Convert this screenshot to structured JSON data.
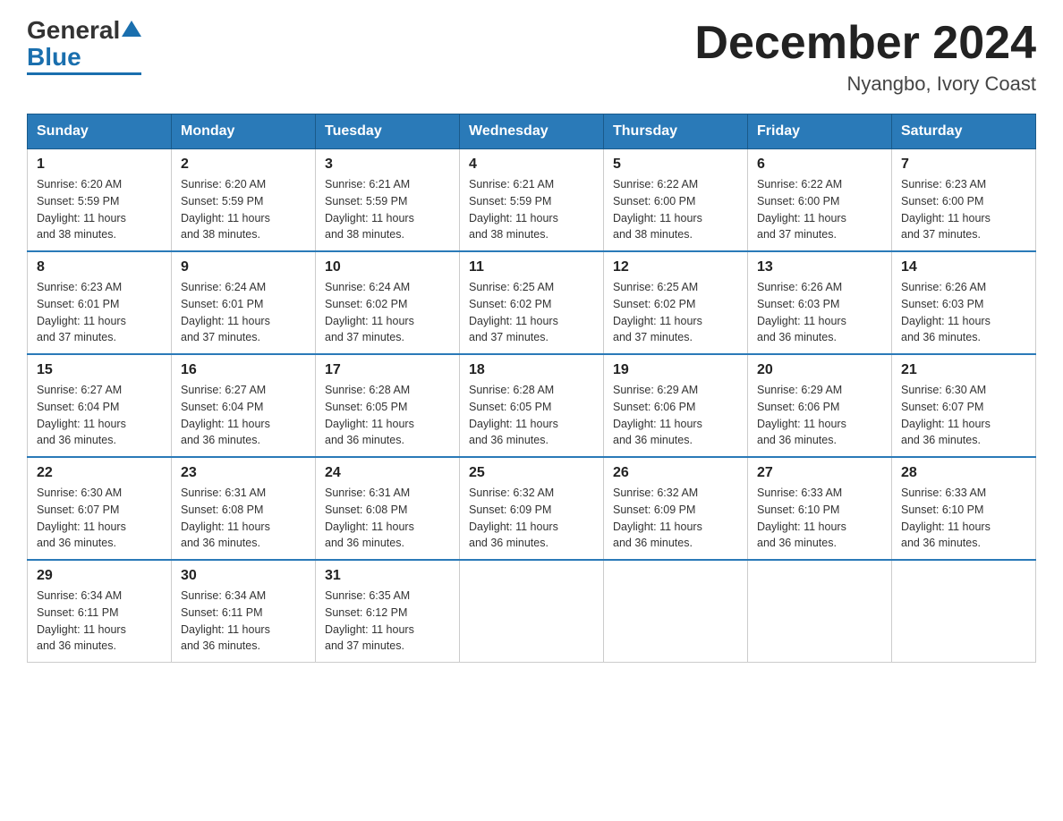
{
  "header": {
    "logo_general": "General",
    "logo_blue": "Blue",
    "month_title": "December 2024",
    "location": "Nyangbo, Ivory Coast"
  },
  "weekdays": [
    "Sunday",
    "Monday",
    "Tuesday",
    "Wednesday",
    "Thursday",
    "Friday",
    "Saturday"
  ],
  "weeks": [
    [
      {
        "day": "1",
        "sunrise": "6:20 AM",
        "sunset": "5:59 PM",
        "daylight": "11 hours and 38 minutes."
      },
      {
        "day": "2",
        "sunrise": "6:20 AM",
        "sunset": "5:59 PM",
        "daylight": "11 hours and 38 minutes."
      },
      {
        "day": "3",
        "sunrise": "6:21 AM",
        "sunset": "5:59 PM",
        "daylight": "11 hours and 38 minutes."
      },
      {
        "day": "4",
        "sunrise": "6:21 AM",
        "sunset": "5:59 PM",
        "daylight": "11 hours and 38 minutes."
      },
      {
        "day": "5",
        "sunrise": "6:22 AM",
        "sunset": "6:00 PM",
        "daylight": "11 hours and 38 minutes."
      },
      {
        "day": "6",
        "sunrise": "6:22 AM",
        "sunset": "6:00 PM",
        "daylight": "11 hours and 37 minutes."
      },
      {
        "day": "7",
        "sunrise": "6:23 AM",
        "sunset": "6:00 PM",
        "daylight": "11 hours and 37 minutes."
      }
    ],
    [
      {
        "day": "8",
        "sunrise": "6:23 AM",
        "sunset": "6:01 PM",
        "daylight": "11 hours and 37 minutes."
      },
      {
        "day": "9",
        "sunrise": "6:24 AM",
        "sunset": "6:01 PM",
        "daylight": "11 hours and 37 minutes."
      },
      {
        "day": "10",
        "sunrise": "6:24 AM",
        "sunset": "6:02 PM",
        "daylight": "11 hours and 37 minutes."
      },
      {
        "day": "11",
        "sunrise": "6:25 AM",
        "sunset": "6:02 PM",
        "daylight": "11 hours and 37 minutes."
      },
      {
        "day": "12",
        "sunrise": "6:25 AM",
        "sunset": "6:02 PM",
        "daylight": "11 hours and 37 minutes."
      },
      {
        "day": "13",
        "sunrise": "6:26 AM",
        "sunset": "6:03 PM",
        "daylight": "11 hours and 36 minutes."
      },
      {
        "day": "14",
        "sunrise": "6:26 AM",
        "sunset": "6:03 PM",
        "daylight": "11 hours and 36 minutes."
      }
    ],
    [
      {
        "day": "15",
        "sunrise": "6:27 AM",
        "sunset": "6:04 PM",
        "daylight": "11 hours and 36 minutes."
      },
      {
        "day": "16",
        "sunrise": "6:27 AM",
        "sunset": "6:04 PM",
        "daylight": "11 hours and 36 minutes."
      },
      {
        "day": "17",
        "sunrise": "6:28 AM",
        "sunset": "6:05 PM",
        "daylight": "11 hours and 36 minutes."
      },
      {
        "day": "18",
        "sunrise": "6:28 AM",
        "sunset": "6:05 PM",
        "daylight": "11 hours and 36 minutes."
      },
      {
        "day": "19",
        "sunrise": "6:29 AM",
        "sunset": "6:06 PM",
        "daylight": "11 hours and 36 minutes."
      },
      {
        "day": "20",
        "sunrise": "6:29 AM",
        "sunset": "6:06 PM",
        "daylight": "11 hours and 36 minutes."
      },
      {
        "day": "21",
        "sunrise": "6:30 AM",
        "sunset": "6:07 PM",
        "daylight": "11 hours and 36 minutes."
      }
    ],
    [
      {
        "day": "22",
        "sunrise": "6:30 AM",
        "sunset": "6:07 PM",
        "daylight": "11 hours and 36 minutes."
      },
      {
        "day": "23",
        "sunrise": "6:31 AM",
        "sunset": "6:08 PM",
        "daylight": "11 hours and 36 minutes."
      },
      {
        "day": "24",
        "sunrise": "6:31 AM",
        "sunset": "6:08 PM",
        "daylight": "11 hours and 36 minutes."
      },
      {
        "day": "25",
        "sunrise": "6:32 AM",
        "sunset": "6:09 PM",
        "daylight": "11 hours and 36 minutes."
      },
      {
        "day": "26",
        "sunrise": "6:32 AM",
        "sunset": "6:09 PM",
        "daylight": "11 hours and 36 minutes."
      },
      {
        "day": "27",
        "sunrise": "6:33 AM",
        "sunset": "6:10 PM",
        "daylight": "11 hours and 36 minutes."
      },
      {
        "day": "28",
        "sunrise": "6:33 AM",
        "sunset": "6:10 PM",
        "daylight": "11 hours and 36 minutes."
      }
    ],
    [
      {
        "day": "29",
        "sunrise": "6:34 AM",
        "sunset": "6:11 PM",
        "daylight": "11 hours and 36 minutes."
      },
      {
        "day": "30",
        "sunrise": "6:34 AM",
        "sunset": "6:11 PM",
        "daylight": "11 hours and 36 minutes."
      },
      {
        "day": "31",
        "sunrise": "6:35 AM",
        "sunset": "6:12 PM",
        "daylight": "11 hours and 37 minutes."
      },
      null,
      null,
      null,
      null
    ]
  ],
  "labels": {
    "sunrise": "Sunrise:",
    "sunset": "Sunset:",
    "daylight": "Daylight:"
  }
}
